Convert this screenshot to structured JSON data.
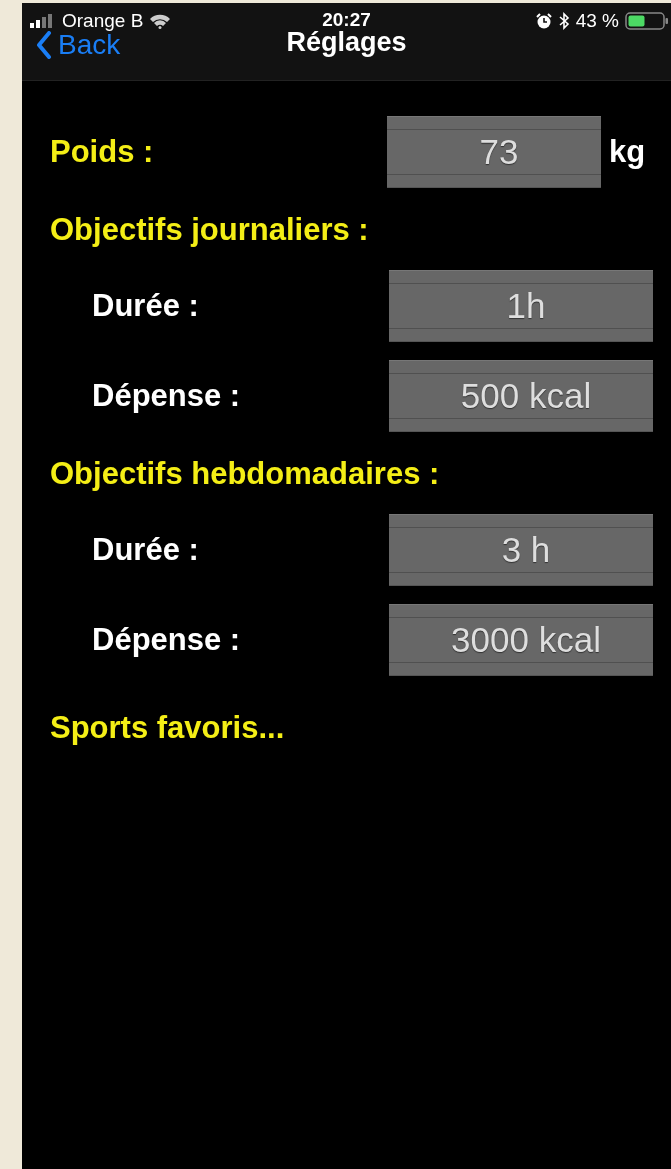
{
  "status_bar": {
    "carrier": "Orange B",
    "time": "20:27",
    "battery": "43 %"
  },
  "nav": {
    "back": "Back",
    "title": "Réglages"
  },
  "weight": {
    "label": "Poids :",
    "value": "73",
    "unit": "kg"
  },
  "sections": [
    {
      "title": "Objectifs journaliers :",
      "fields": [
        {
          "label": "Durée :",
          "value": "1h"
        },
        {
          "label": "Dépense :",
          "value": "500 kcal"
        }
      ]
    },
    {
      "title": "Objectifs hebdomadaires :",
      "fields": [
        {
          "label": "Durée :",
          "value": "3 h"
        },
        {
          "label": "Dépense :",
          "value": "3000 kcal"
        }
      ]
    }
  ],
  "favorites": "Sports favoris..."
}
